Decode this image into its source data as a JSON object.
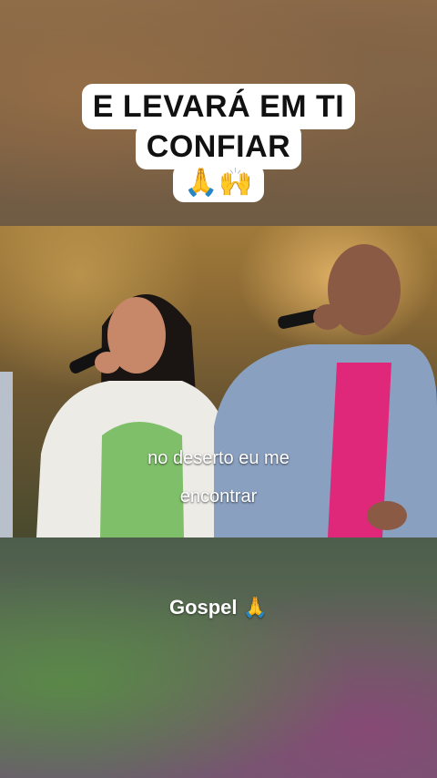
{
  "caption": {
    "line1": "E LEVARÁ EM TI",
    "line2": "CONFIAR",
    "emojis": "🙏🙌"
  },
  "video": {
    "subtitle_line1": "no deserto eu me",
    "subtitle_line2": "encontrar"
  },
  "footer": {
    "text": "Gospel 🙏"
  },
  "colors": {
    "caption_bg": "#ffffff",
    "caption_text": "#111111",
    "shirt_pink": "#e0287a",
    "shirt_green": "#7fbf6a",
    "denim": "#8aa0c0"
  }
}
